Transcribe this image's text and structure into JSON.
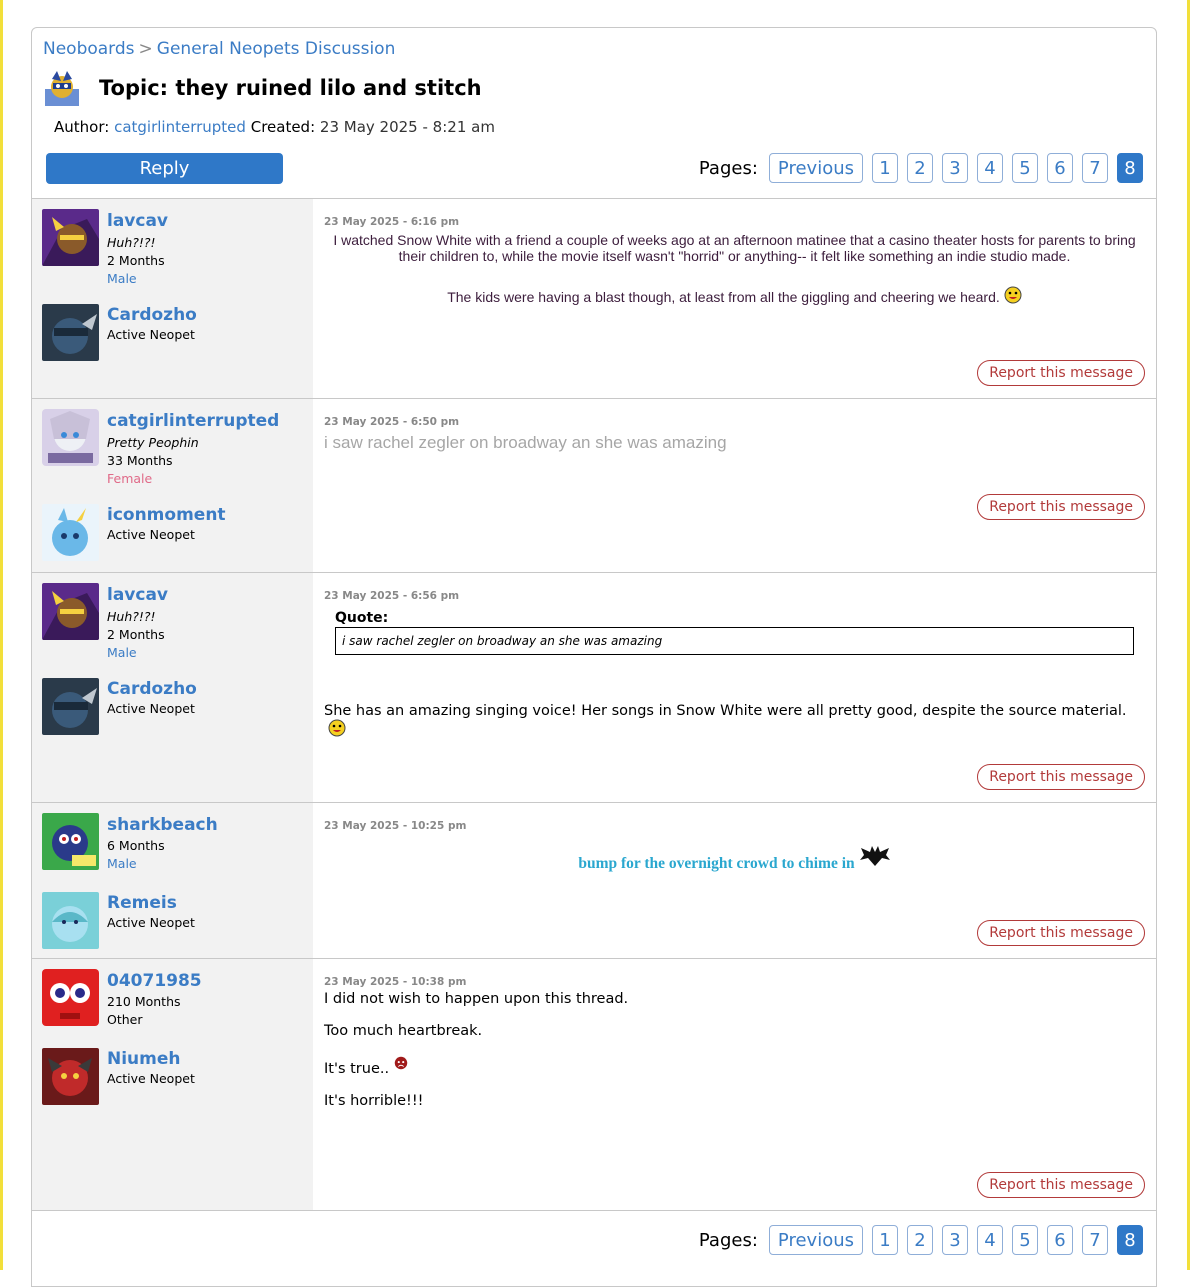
{
  "breadcrumb": {
    "root": "Neoboards",
    "separator": ">",
    "board": "General Neopets Discussion"
  },
  "topic": {
    "title": "Topic: they ruined lilo and stitch",
    "author_label": "Author:",
    "author": "catgirlinterrupted",
    "created_label": "Created:",
    "created": "23 May 2025 - 8:21 am"
  },
  "reply_label": "Reply",
  "pager": {
    "label": "Pages:",
    "previous": "Previous",
    "pages": [
      "1",
      "2",
      "3",
      "4",
      "5",
      "6",
      "7",
      "8"
    ],
    "current": "8"
  },
  "report_label": "Report this message",
  "posts": [
    {
      "user": {
        "name": "lavcav",
        "title": "Huh?!?!",
        "age": "2 Months",
        "gender": "Male"
      },
      "pet": {
        "name": "Cardozho",
        "status": "Active Neopet"
      },
      "date": "23 May 2025 - 6:16 pm",
      "lines": [
        "I watched Snow White with a friend a couple of weeks ago at an afternoon matinee that a casino theater hosts for parents to bring their children to, while the movie itself wasn't \"horrid\" or anything-- it felt like something an indie studio made.",
        "The kids were having a blast though, at least from all the giggling and cheering we heard."
      ]
    },
    {
      "user": {
        "name": "catgirlinterrupted",
        "title": "Pretty Peophin",
        "age": "33 Months",
        "gender": "Female"
      },
      "pet": {
        "name": "iconmoment",
        "status": "Active Neopet"
      },
      "date": "23 May 2025 - 6:50 pm",
      "lines": [
        "i saw rachel zegler on broadway an she was amazing"
      ]
    },
    {
      "user": {
        "name": "lavcav",
        "title": "Huh?!?!",
        "age": "2 Months",
        "gender": "Male"
      },
      "pet": {
        "name": "Cardozho",
        "status": "Active Neopet"
      },
      "date": "23 May 2025 - 6:56 pm",
      "quote_label": "Quote:",
      "quote": "i saw rachel zegler on broadway an she was amazing",
      "lines": [
        "She has an amazing singing voice! Her songs in Snow White were all pretty good, despite the source material."
      ]
    },
    {
      "user": {
        "name": "sharkbeach",
        "age": "6 Months",
        "gender": "Male"
      },
      "pet": {
        "name": "Remeis",
        "status": "Active Neopet"
      },
      "date": "23 May 2025 - 10:25 pm",
      "lines": [
        "bump for the overnight crowd to chime in"
      ]
    },
    {
      "user": {
        "name": "04071985",
        "age": "210 Months",
        "gender": "Other"
      },
      "pet": {
        "name": "Niumeh",
        "status": "Active Neopet"
      },
      "date": "23 May 2025 - 10:38 pm",
      "lines": [
        "I did not wish to happen upon this thread.",
        "Too much heartbreak.",
        "It's true..",
        "It's horrible!!!"
      ]
    }
  ],
  "icons": {
    "topic": "pet-avatar-icon",
    "smiley": "grin-smiley-icon",
    "bat": "bat-icon",
    "sad": "sad-smiley-icon"
  },
  "colors": {
    "link": "#3b7cc5",
    "reply_button": "#2f78c8",
    "report": "#b23a3a",
    "border_yellow": "#f2df3a"
  }
}
